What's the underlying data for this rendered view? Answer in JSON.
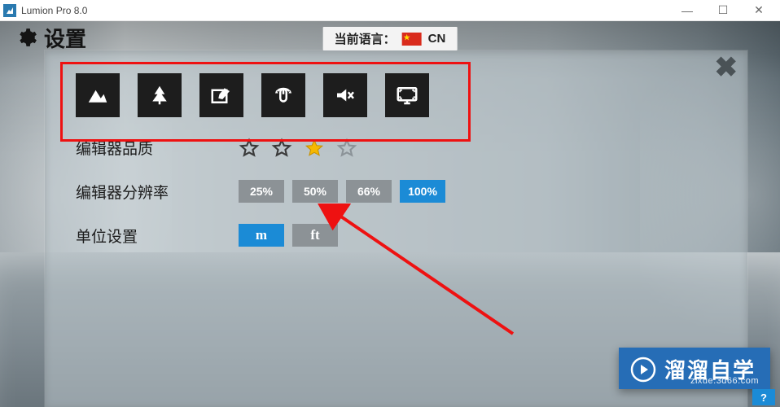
{
  "window": {
    "title": "Lumion Pro 8.0",
    "min_glyph": "—",
    "max_glyph": "☐",
    "close_glyph": "✕"
  },
  "header": {
    "settings_title": "设置",
    "language_label": "当前语言：",
    "language_code": "CN"
  },
  "panel": {
    "icons": [
      {
        "name": "terrain-icon"
      },
      {
        "name": "tree-icon"
      },
      {
        "name": "tablet-edit-icon"
      },
      {
        "name": "mouse-rotate-icon"
      },
      {
        "name": "mute-icon"
      },
      {
        "name": "monitor-icon"
      }
    ],
    "close_glyph": "✖",
    "rows": {
      "quality": {
        "label": "编辑器品质",
        "stars": [
          "empty",
          "empty",
          "filled",
          "dim"
        ]
      },
      "resolution": {
        "label": "编辑器分辨率",
        "options": [
          {
            "text": "25%",
            "active": false
          },
          {
            "text": "50%",
            "active": false
          },
          {
            "text": "66%",
            "active": false
          },
          {
            "text": "100%",
            "active": true
          }
        ]
      },
      "units": {
        "label": "单位设置",
        "options": [
          {
            "text": "m",
            "active": true
          },
          {
            "text": "ft",
            "active": false
          }
        ]
      }
    }
  },
  "brand": {
    "text": "溜溜自学",
    "sub": "zixue.3d66.com"
  },
  "help": {
    "label": "?"
  }
}
